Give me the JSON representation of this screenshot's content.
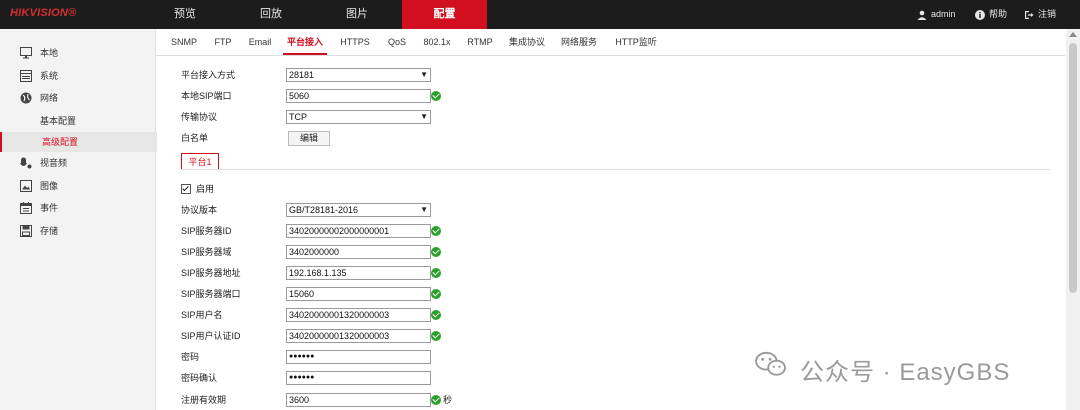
{
  "brand": {
    "logo": "HIKVISION®"
  },
  "top_nav": [
    {
      "label": "预览",
      "active": false
    },
    {
      "label": "回放",
      "active": false
    },
    {
      "label": "图片",
      "active": false
    },
    {
      "label": "配置",
      "active": true
    }
  ],
  "user_bar": {
    "user": "admin",
    "help": "帮助",
    "logout": "注销"
  },
  "sidebar": {
    "items": [
      {
        "label": "本地",
        "icon": "monitor-icon"
      },
      {
        "label": "系统",
        "icon": "system-icon"
      },
      {
        "label": "网络",
        "icon": "globe-icon"
      },
      {
        "label": "基本配置",
        "sub": true
      },
      {
        "label": "高级配置",
        "sub": true,
        "selected": true
      },
      {
        "label": "视音频",
        "icon": "audio-video-icon"
      },
      {
        "label": "图像",
        "icon": "image-icon"
      },
      {
        "label": "事件",
        "icon": "calendar-icon"
      },
      {
        "label": "存储",
        "icon": "storage-icon"
      }
    ]
  },
  "tabs": [
    "SNMP",
    "FTP",
    "Email",
    "平台接入",
    "HTTPS",
    "QoS",
    "802.1x",
    "RTMP",
    "集成协议",
    "网络服务",
    "HTTP监听"
  ],
  "active_tab": "平台接入",
  "form": {
    "access_mode": {
      "label": "平台接入方式",
      "value": "28181"
    },
    "local_sip_port": {
      "label": "本地SIP端口",
      "value": "5060"
    },
    "transport": {
      "label": "传输协议",
      "value": "TCP"
    },
    "whitelist": {
      "label": "白名单",
      "button": "编辑"
    }
  },
  "platform_tab": "平台1",
  "platform": {
    "enable": {
      "label": "启用",
      "checked": true
    },
    "protocol_version": {
      "label": "协议版本",
      "value": "GB/T28181-2016"
    },
    "sip_server_id": {
      "label": "SIP服务器ID",
      "value": "34020000002000000001"
    },
    "sip_server_domain": {
      "label": "SIP服务器域",
      "value": "3402000000"
    },
    "sip_server_address": {
      "label": "SIP服务器地址",
      "value": "192.168.1.135"
    },
    "sip_server_port": {
      "label": "SIP服务器端口",
      "value": "15060"
    },
    "sip_username": {
      "label": "SIP用户名",
      "value": "34020000001320000003"
    },
    "sip_auth_id": {
      "label": "SIP用户认证ID",
      "value": "34020000001320000003"
    },
    "password": {
      "label": "密码",
      "value": "●●●●●●"
    },
    "password_confirm": {
      "label": "密码确认",
      "value": "●●●●●●"
    },
    "register_validity": {
      "label": "注册有效期",
      "value": "3600",
      "unit": "秒"
    }
  },
  "watermark": "公众号 · EasyGBS",
  "colors": {
    "accent": "#d10f1f",
    "topbar": "#1c1c1c",
    "ok": "#2aa02a"
  }
}
